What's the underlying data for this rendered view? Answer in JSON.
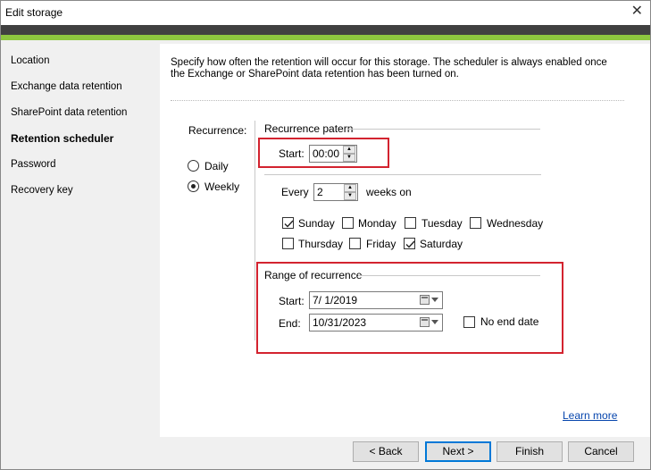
{
  "window": {
    "title": "Edit storage",
    "close_glyph": "✕"
  },
  "sidebar": {
    "items": [
      {
        "label": "Location",
        "active": false
      },
      {
        "label": "Exchange data retention",
        "active": false
      },
      {
        "label": "SharePoint data retention",
        "active": false
      },
      {
        "label": "Retention scheduler",
        "active": true
      },
      {
        "label": "Password",
        "active": false
      },
      {
        "label": "Recovery key",
        "active": false
      }
    ]
  },
  "main": {
    "description": "Specify how often the retention will occur for this storage. The scheduler is always enabled once the Exchange or SharePoint data retention has been turned on.",
    "recurrence_label": "Recurrence:",
    "options": {
      "daily": "Daily",
      "weekly": "Weekly",
      "selected": "Weekly"
    },
    "pattern": {
      "heading": "Recurrence patern",
      "start_label": "Start:",
      "start_time": "00:00",
      "every_label": "Every",
      "every_value": "2",
      "weeks_on_label": "weeks on",
      "days": [
        {
          "label": "Sunday",
          "checked": true
        },
        {
          "label": "Monday",
          "checked": false
        },
        {
          "label": "Tuesday",
          "checked": false
        },
        {
          "label": "Wednesday",
          "checked": false
        },
        {
          "label": "Thursday",
          "checked": false
        },
        {
          "label": "Friday",
          "checked": false
        },
        {
          "label": "Saturday",
          "checked": true
        }
      ]
    },
    "range": {
      "heading": "Range of recurrence",
      "start_label": "Start:",
      "start_date": "7/  1/2019",
      "end_label": "End:",
      "end_date": "10/31/2023",
      "no_end_label": "No end date",
      "no_end_checked": false
    },
    "learn_more": "Learn more"
  },
  "footer": {
    "back": "< Back",
    "next": "Next >",
    "finish": "Finish",
    "cancel": "Cancel"
  },
  "colors": {
    "accent_green": "#8dc63f",
    "dark_band": "#404040",
    "highlight_red": "#d3232f",
    "link": "#0645ad"
  }
}
